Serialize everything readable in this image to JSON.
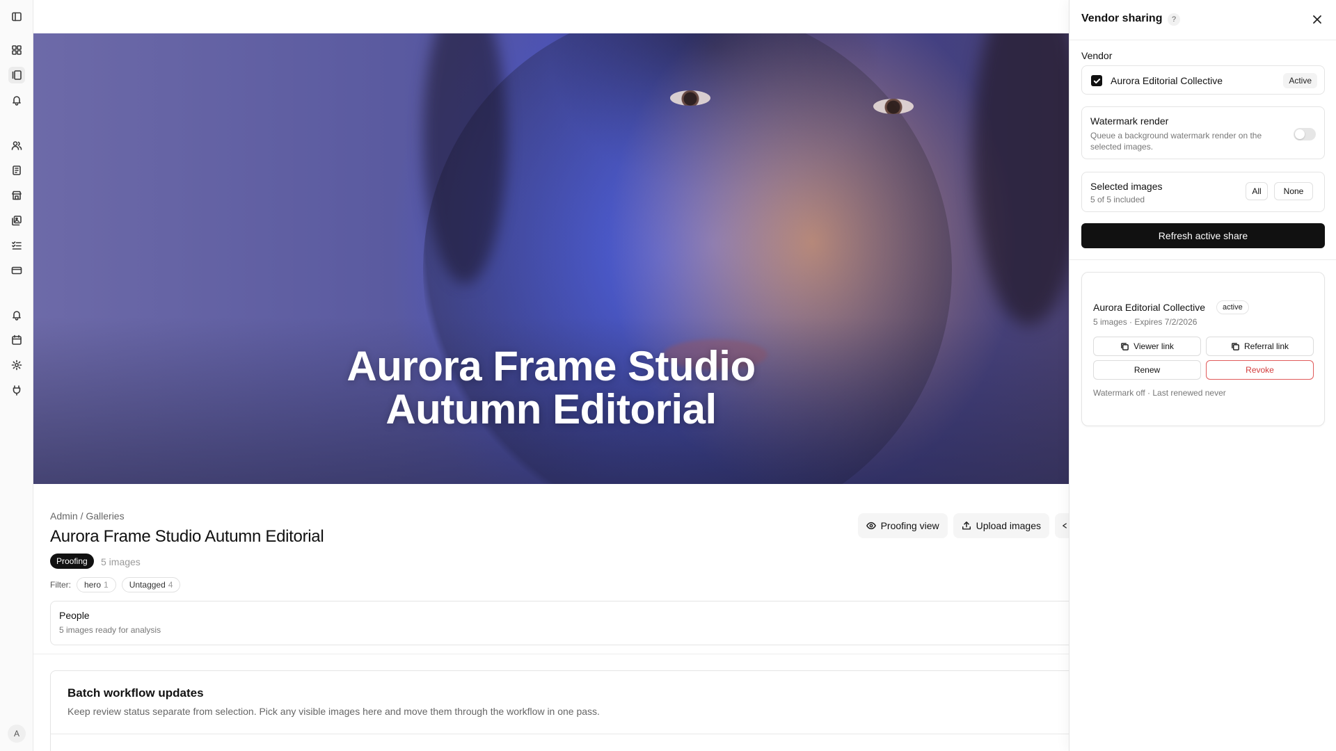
{
  "hero": {
    "title_line1": "Aurora Frame Studio",
    "title_line2": "Autumn Editorial"
  },
  "breadcrumb": "Admin / Galleries",
  "gallery": {
    "title": "Aurora Frame Studio Autumn Editorial",
    "status": "Proofing",
    "count": "5 images"
  },
  "filter": {
    "label": "Filter:",
    "chips": [
      {
        "label": "hero",
        "count": "1"
      },
      {
        "label": "Untagged",
        "count": "4"
      }
    ]
  },
  "actions": {
    "proofing_view": "Proofing view",
    "upload_images": "Upload images"
  },
  "people": {
    "title": "People",
    "subtitle": "5 images ready for analysis"
  },
  "batch": {
    "title": "Batch workflow updates",
    "subtitle": "Keep review status separate from selection. Pick any visible images here and move them through the workflow in one pass."
  },
  "user": {
    "avatar_initial": "A"
  },
  "panel": {
    "title": "Vendor sharing",
    "help": "?",
    "vendor_label": "Vendor",
    "vendor": {
      "name": "Aurora Editorial Collective",
      "badge": "Active",
      "checked": true
    },
    "watermark": {
      "title": "Watermark render",
      "description": "Queue a background watermark render on the selected images.",
      "enabled": false
    },
    "selected": {
      "title": "Selected images",
      "summary": "5 of 5 included",
      "all_label": "All",
      "none_label": "None"
    },
    "refresh_label": "Refresh active share",
    "share": {
      "name": "Aurora Editorial Collective",
      "status": "active",
      "meta": "5 images · Expires 7/2/2026",
      "viewer_link": "Viewer link",
      "referral_link": "Referral link",
      "renew": "Renew",
      "revoke": "Revoke",
      "footer": "Watermark off · Last renewed never"
    }
  },
  "colors": {
    "primary": "#111111",
    "danger": "#d23b3b",
    "accent_panel_bg": "#ffffff"
  },
  "icons": {
    "rail": [
      "sidebar-toggle-icon",
      "dashboard-icon",
      "galleries-icon",
      "notifications-icon",
      "clients-icon",
      "documents-icon",
      "store-icon",
      "images-icon",
      "tasks-icon",
      "billing-icon",
      "alerts-icon",
      "calendar-icon",
      "settings-icon",
      "integrations-icon"
    ]
  }
}
